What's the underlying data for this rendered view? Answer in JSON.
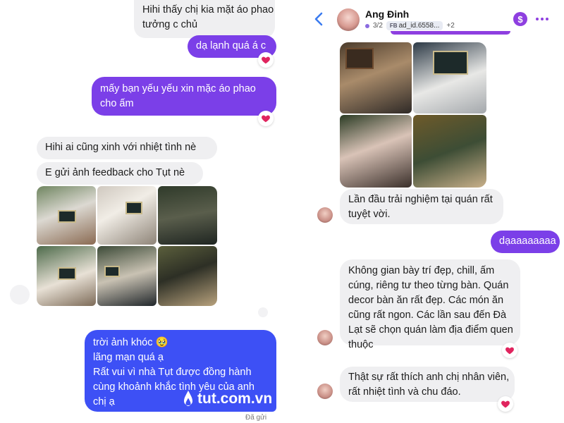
{
  "left_chat": {
    "messages": [
      {
        "lines": [
          "Hihi thấy chị kia mặt áo phao",
          "tưởng c chủ"
        ]
      },
      {
        "lines": [
          "dạ lạnh quá á c"
        ],
        "reaction": "heart"
      },
      {
        "lines": [
          "mấy bạn yếu yếu xin mặc áo phao",
          "cho ấm"
        ],
        "reaction": "heart"
      },
      {
        "lines": [
          "Hihi ai cũng xinh với nhiệt tình nè"
        ]
      },
      {
        "lines": [
          "E gửi ảnh feedback cho Tụt nè"
        ]
      },
      {
        "lines": [
          "trời ảnh khóc 🥹",
          "lãng mạn quá ạ",
          "Rất vui vì nhà Tụt được đồng hành",
          "cùng khoảnh khắc tình yêu của anh",
          "chị ạ"
        ]
      }
    ],
    "status": "Đã gửi",
    "brand": "tut.com.vn"
  },
  "right_chat": {
    "header": {
      "title": "Ang Đinh",
      "count": "3/2",
      "fb_tag": "FB",
      "ad_id": "ad_id.6558...",
      "extra": "+2"
    },
    "messages": [
      {
        "lines": [
          "Lần đầu trải nghiệm tại quán rất",
          "tuyệt vời."
        ]
      },
      {
        "lines": [
          "dạaaaaaaaa"
        ]
      },
      {
        "lines": [
          "Không gian bày trí đẹp, chill, ấm",
          "cúng, riêng tư theo từng bàn. Quán",
          "decor bàn ăn rất đẹp. Các món ăn",
          "cũng rất ngon. Các lần sau đến Đà",
          "Lạt sẽ chọn quán làm địa điểm quen",
          "thuộc"
        ],
        "reaction": "heart"
      },
      {
        "lines": [
          "Thật sự rất thích anh chị nhân viên,",
          "rất nhiệt tình và chu đáo."
        ],
        "reaction": "heart"
      }
    ]
  },
  "colors": {
    "purple_bubble": "#7b3fe8",
    "blue_bubble": "#3d50f5",
    "incoming_bubble": "#efeff1",
    "accent": "#8e3fe0",
    "heart": "#e0245e"
  },
  "icons": [
    "back-arrow-icon",
    "dollar-icon",
    "more-icon",
    "heart-icon",
    "brand-logo-icon"
  ]
}
